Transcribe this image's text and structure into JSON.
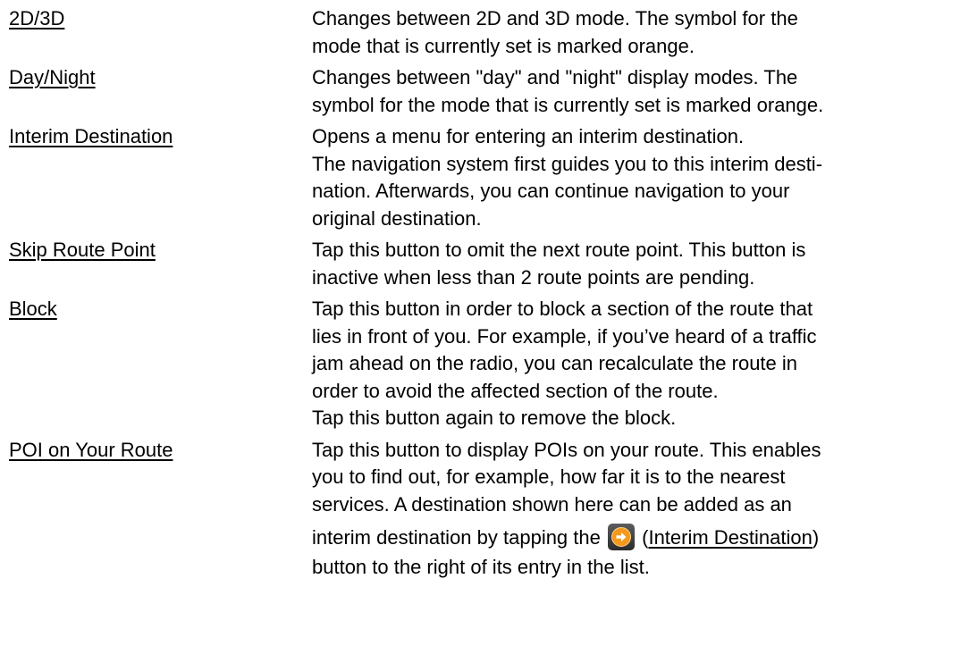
{
  "entries": [
    {
      "term": "2D/3D",
      "lines": [
        "Changes between 2D and 3D mode. The symbol for the",
        "mode that is currently set is marked orange."
      ]
    },
    {
      "term": "Day/Night",
      "lines": [
        "Changes between \"day\" and \"night\" display modes. The",
        "symbol for the mode that is currently set is marked orange."
      ]
    },
    {
      "term": "Interim Destination",
      "lines": [
        "Opens a menu for entering an interim destination.",
        "The navigation system first guides you to this interim desti-",
        "nation. Afterwards, you can continue navigation to your",
        "original destination."
      ]
    },
    {
      "term": "Skip Route Point",
      "lines": [
        "Tap this button to omit the next route point. This button is",
        "inactive when less than 2 route points are pending."
      ]
    },
    {
      "term": "Block",
      "lines": [
        "Tap this button in order to block a section of the route that",
        "lies in front of you. For example, if you’ve heard of a traffic",
        "jam ahead on the radio, you can recalculate the route in",
        "order to avoid the affected section of the route.",
        "Tap this button again to remove the block."
      ]
    },
    {
      "term": "POI on Your Route",
      "lines": [
        "Tap this button to display POIs on your route. This enables",
        "you to find out, for example, how far it is to the nearest",
        "services. A destination shown here can be added as an"
      ],
      "icon_line": {
        "before": "interim destination by tapping the",
        "icon": "interim-destination-arrow-icon",
        "paren_open": "(",
        "link": "Interim Destination",
        "paren_close": ")"
      },
      "last_line": "button to the right of its entry in the list."
    }
  ],
  "colors": {
    "icon_orange": "#f39a1e",
    "icon_background": "#3a3a3a",
    "text": "#000000"
  }
}
